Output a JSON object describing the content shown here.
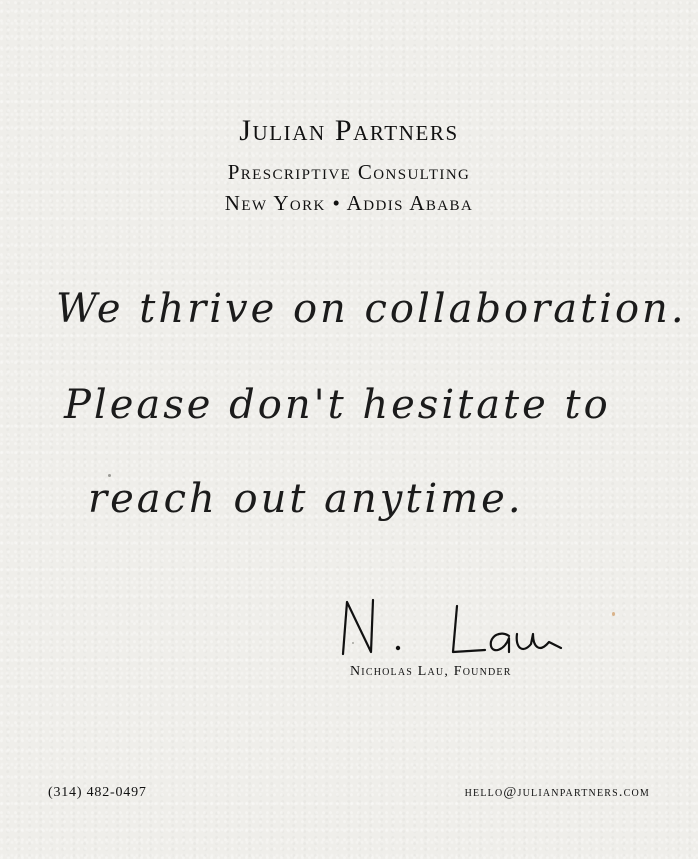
{
  "header": {
    "company_name": "Julian Partners",
    "tagline": "Prescriptive Consulting",
    "locations": "New York • Addis Ababa"
  },
  "note": {
    "line1": "We thrive on collaboration.",
    "line2": "Please don't hesitate to",
    "line3": "reach out anytime."
  },
  "signature": {
    "handwritten": "N. Lau",
    "signer": "Nicholas Lau, Founder"
  },
  "footer": {
    "phone": "(314) 482-0497",
    "email": "hello@julianpartners.com"
  },
  "colors": {
    "paper": "#efeeea",
    "ink": "#111111"
  }
}
